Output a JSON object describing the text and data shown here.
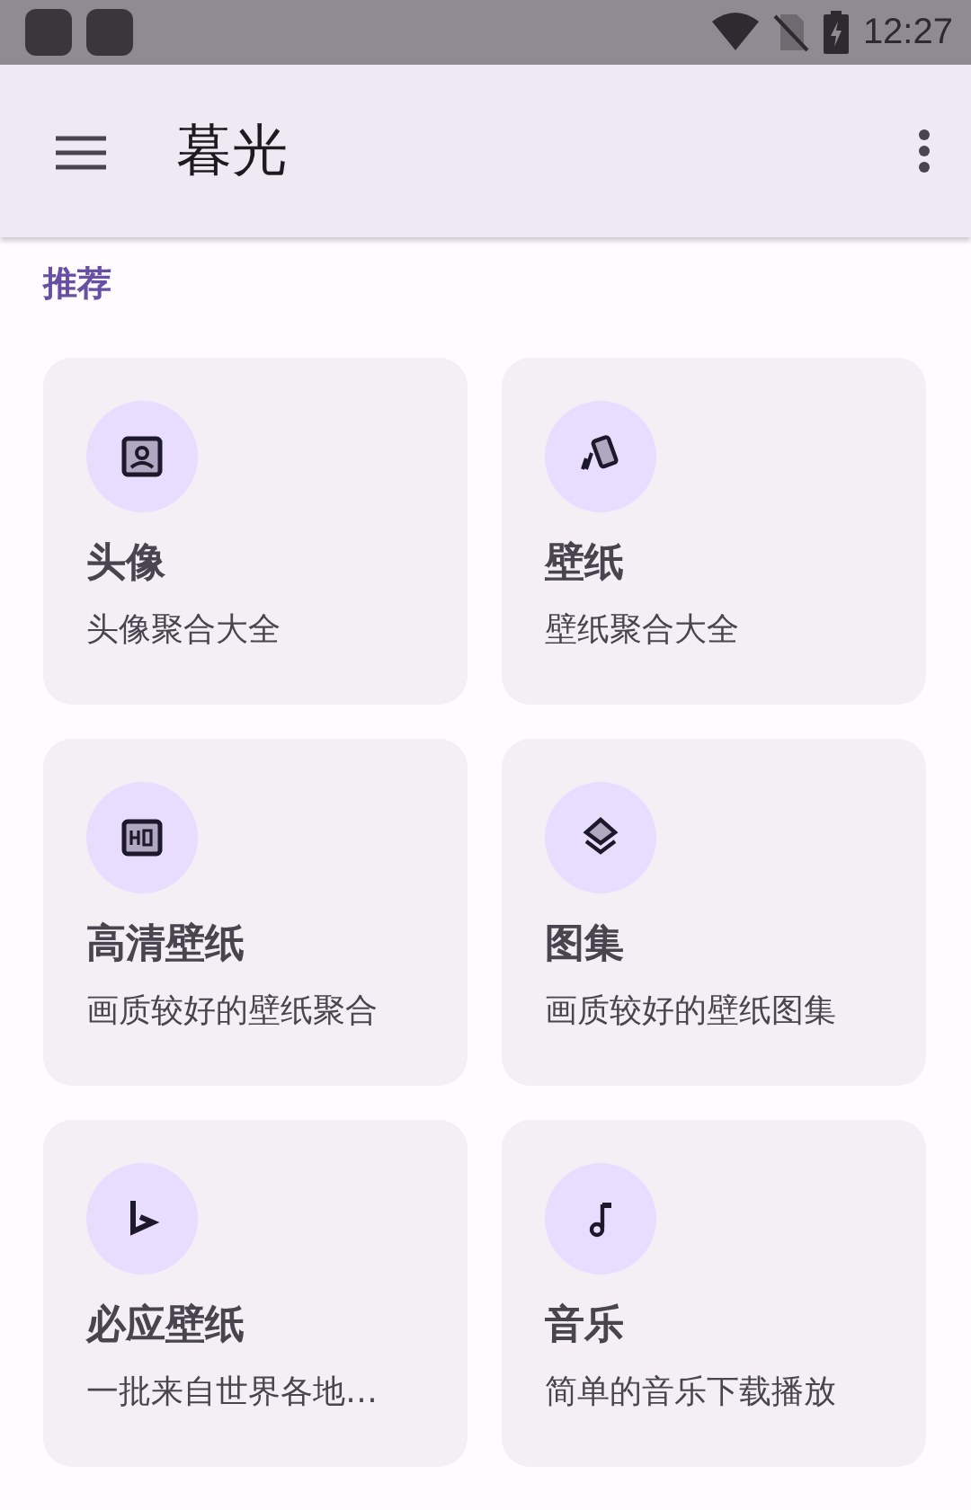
{
  "status_bar": {
    "time": "12:27"
  },
  "app_bar": {
    "title": "暮光"
  },
  "section": {
    "title": "推荐"
  },
  "cards": [
    {
      "title": "头像",
      "subtitle": "头像聚合大全"
    },
    {
      "title": "壁纸",
      "subtitle": "壁纸聚合大全"
    },
    {
      "title": "高清壁纸",
      "subtitle": "画质较好的壁纸聚合"
    },
    {
      "title": "图集",
      "subtitle": "画质较好的壁纸图集"
    },
    {
      "title": "必应壁纸",
      "subtitle": "一批来自世界各地…"
    },
    {
      "title": "音乐",
      "subtitle": "简单的音乐下载播放"
    }
  ]
}
